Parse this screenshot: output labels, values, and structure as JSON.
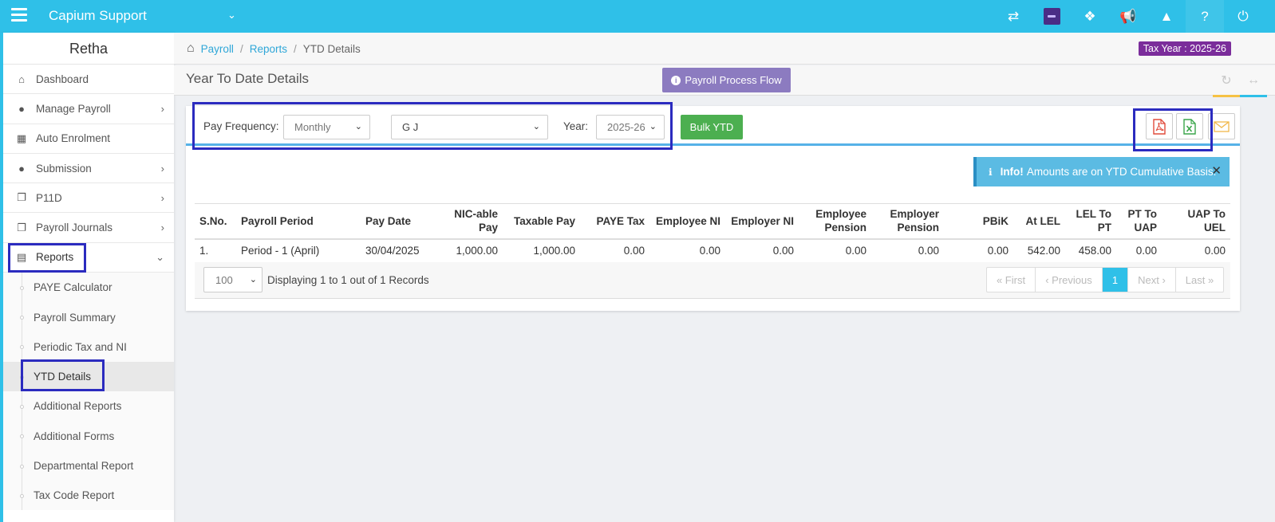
{
  "topbar": {
    "brand": "Capium Support",
    "icons": [
      "switch-icon",
      "avatar-icon",
      "cubes-icon",
      "megaphone-icon",
      "ticket-icon",
      "help-icon",
      "power-icon"
    ]
  },
  "sidebar": {
    "user_name": "Retha",
    "items": [
      {
        "label": "Dashboard",
        "icon": "home-icon",
        "has_arrow": false
      },
      {
        "label": "Manage Payroll",
        "icon": "user-icon",
        "has_arrow": true
      },
      {
        "label": "Auto Enrolment",
        "icon": "grid-icon",
        "has_arrow": false
      },
      {
        "label": "Submission",
        "icon": "users-icon",
        "has_arrow": true
      },
      {
        "label": "P11D",
        "icon": "copy-icon",
        "has_arrow": true
      },
      {
        "label": "Payroll Journals",
        "icon": "copy-icon",
        "has_arrow": true
      },
      {
        "label": "Reports",
        "icon": "report-icon",
        "has_arrow": true,
        "open": true
      }
    ],
    "sub_items": [
      {
        "label": "PAYE Calculator"
      },
      {
        "label": "Payroll Summary"
      },
      {
        "label": "Periodic Tax and NI"
      },
      {
        "label": "YTD Details",
        "active": true
      },
      {
        "label": "Additional Reports"
      },
      {
        "label": "Additional Forms"
      },
      {
        "label": "Departmental Report"
      },
      {
        "label": "Tax Code Report"
      }
    ]
  },
  "breadcrumb": {
    "items": [
      "Payroll",
      "Reports"
    ],
    "separator": "/",
    "current": "YTD Details"
  },
  "tax_year_badge": "Tax Year : 2025-26",
  "page": {
    "title": "Year To Date Details",
    "flow_button": "Payroll Process Flow"
  },
  "filters": {
    "pay_frequency_label": "Pay Frequency:",
    "pay_frequency_value": "Monthly",
    "employee_value": "G J",
    "year_label": "Year:",
    "year_value": "2025-26",
    "bulk_button": "Bulk YTD"
  },
  "export": {
    "pdf": "pdf-icon",
    "excel": "excel-icon",
    "email": "email-icon"
  },
  "info_alert": {
    "title": "Info!",
    "message": "Amounts are on YTD Cumulative Basis."
  },
  "table": {
    "columns": [
      {
        "label": "S.No.",
        "align": "l"
      },
      {
        "label": "Payroll Period",
        "align": "l"
      },
      {
        "label": "Pay Date",
        "align": "l"
      },
      {
        "label": "NIC-able Pay",
        "align": "r"
      },
      {
        "label": "Taxable Pay",
        "align": "r"
      },
      {
        "label": "PAYE Tax",
        "align": "r"
      },
      {
        "label": "Employee NI",
        "align": "r"
      },
      {
        "label": "Employer NI",
        "align": "r"
      },
      {
        "label": "Employee Pension",
        "align": "r"
      },
      {
        "label": "Employer Pension",
        "align": "r"
      },
      {
        "label": "PBiK",
        "align": "r"
      },
      {
        "label": "At LEL",
        "align": "r"
      },
      {
        "label": "LEL To PT",
        "align": "r"
      },
      {
        "label": "PT To UAP",
        "align": "r"
      },
      {
        "label": "UAP To UEL",
        "align": "r"
      }
    ],
    "rows": [
      [
        "1.",
        "Period - 1 (April)",
        "30/04/2025",
        "1,000.00",
        "1,000.00",
        "0.00",
        "0.00",
        "0.00",
        "0.00",
        "0.00",
        "0.00",
        "542.00",
        "458.00",
        "0.00",
        "0.00"
      ]
    ]
  },
  "footer": {
    "per_page": "100",
    "records_info": "Displaying 1 to 1 out of 1 Records",
    "pager": {
      "first": "« First",
      "previous": "‹ Previous",
      "current": "1",
      "next": "Next ›",
      "last": "Last »"
    }
  },
  "colors": {
    "topbar": "#2fc0e8",
    "tax_badge": "#7b2d9b",
    "flow_button": "#8c7bc0",
    "bulk_button": "#4caf50",
    "info_alert": "#5bbbe3",
    "highlight": "#2b2bbf"
  }
}
